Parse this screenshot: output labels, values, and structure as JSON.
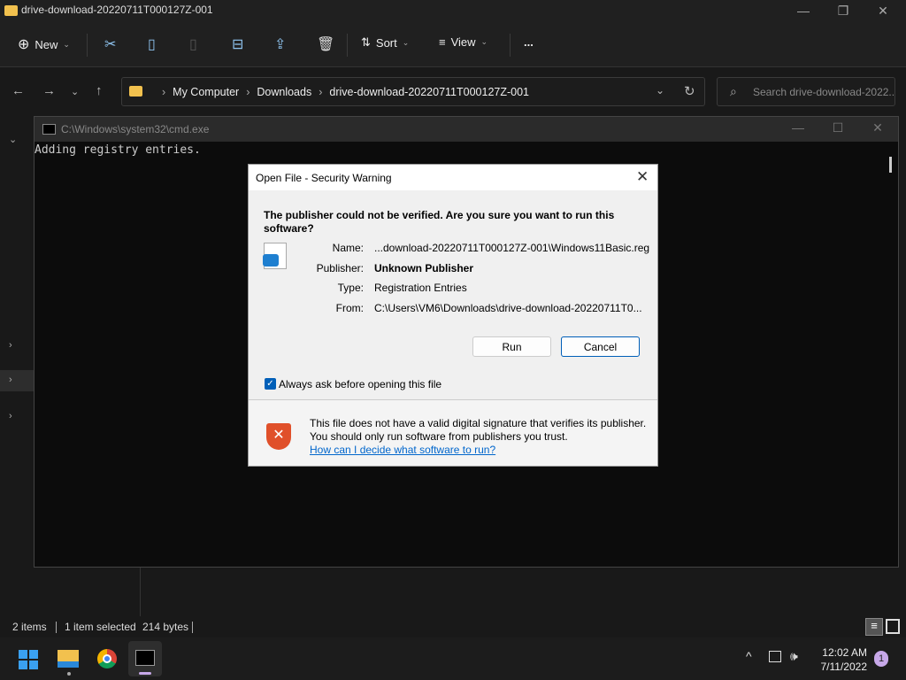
{
  "explorer": {
    "title": "drive-download-20220711T000127Z-001",
    "toolbar": {
      "new": "New",
      "sort": "Sort",
      "view": "View",
      "more": "..."
    },
    "breadcrumb": [
      "My Computer",
      "Downloads",
      "drive-download-20220711T000127Z-001"
    ],
    "search_placeholder": "Search drive-download-2022...",
    "status": {
      "items": "2 items",
      "selected": "1 item selected",
      "size": "214 bytes"
    }
  },
  "cmd": {
    "title": "C:\\Windows\\system32\\cmd.exe",
    "output": "Adding registry entries."
  },
  "dialog": {
    "title": "Open File - Security Warning",
    "question": "The publisher could not be verified.  Are you sure you want to run this software?",
    "fields": [
      {
        "label": "Name:",
        "value": "...download-20220711T000127Z-001\\Windows11Basic.reg"
      },
      {
        "label": "Publisher:",
        "value": "Unknown Publisher"
      },
      {
        "label": "Type:",
        "value": "Registration Entries"
      },
      {
        "label": "From:",
        "value": "C:\\Users\\VM6\\Downloads\\drive-download-20220711T0..."
      }
    ],
    "run": "Run",
    "cancel": "Cancel",
    "checkbox": {
      "label": "Always ask before opening this file",
      "checked": true
    },
    "warning": "This file does not have a valid digital signature that verifies its publisher.  You should only run software from publishers you trust.",
    "help_link": "How can I decide what software to run?"
  },
  "taskbar": {
    "time": "12:02 AM",
    "date": "7/11/2022",
    "notifications": "1"
  },
  "colors": {
    "accent": "#005fb8",
    "link": "#0066cc",
    "shield": "#e0502a"
  }
}
